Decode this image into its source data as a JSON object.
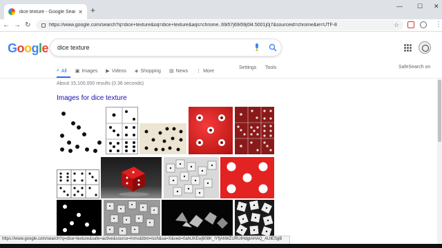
{
  "browser": {
    "tab_title": "dice texture - Google Search",
    "url": "https://www.google.com/search?q=dice+texture&oq=dice+texture&aqs=chrome..69i57j69i59j0l4.5001j0j7&sourceid=chrome&ie=UTF-8"
  },
  "search": {
    "logo": [
      "G",
      "o",
      "o",
      "g",
      "l",
      "e"
    ],
    "logo_colors": [
      "#4285f4",
      "#ea4335",
      "#fbbc05",
      "#4285f4",
      "#34a853",
      "#ea4335"
    ],
    "query": "dice texture"
  },
  "nav": {
    "all": "All",
    "images": "Images",
    "videos": "Videos",
    "shopping": "Shopping",
    "news": "News",
    "more": "More",
    "settings": "Settings",
    "tools": "Tools",
    "safesearch": "SafeSearch on"
  },
  "results": {
    "stats": "About 15,100,000 results (0.36 seconds)",
    "images_heading": "Images for dice texture"
  },
  "status_url": "https://www.google.com/search?q=dice+texture&safe=active&source=lnms&tbm=isch&sa=X&ved=0ahUKEwj908K_lYfjAhWZURUIHdgIAHAQ_AUIESgB",
  "colors": {
    "link": "#1a0dab",
    "active_tab": "#1a73e8",
    "dice_red": "#d81f1f"
  }
}
